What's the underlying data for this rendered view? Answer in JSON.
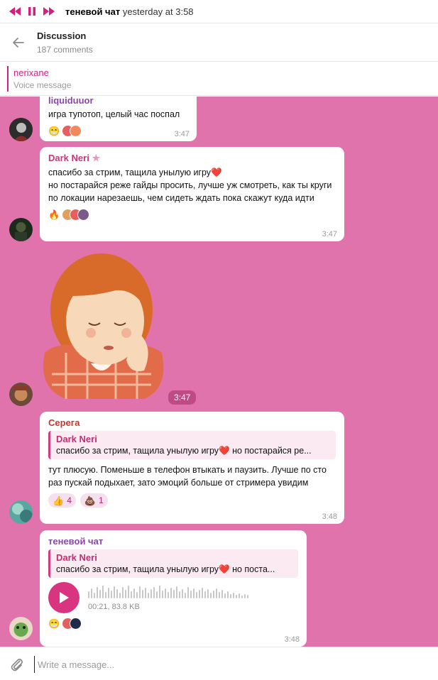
{
  "player": {
    "title": "теневой чат",
    "subtitle": "yesterday at 3:58"
  },
  "header": {
    "title": "Discussion",
    "subtitle": "187 comments"
  },
  "pinned": {
    "name": "nerixane",
    "text": "Voice message"
  },
  "messages": [
    {
      "sender": "liquiduuor",
      "text": "игра тупотоп, целый час поспал",
      "time": "3:47",
      "reactions": [
        "😁"
      ]
    },
    {
      "sender": "Dark Neri",
      "text_line1": "спасибо за стрим, тащила унылую игру❤️",
      "text_rest": "но постарайся реже гайды просить, лучше уж смотреть, как ты круги по локации нарезаешь, чем сидеть ждать пока скажут куда идти",
      "time": "3:47",
      "reactions": [
        "🔥"
      ]
    },
    {
      "type": "sticker",
      "time": "3:47"
    },
    {
      "sender": "Серега",
      "quote_name": "Dark Neri",
      "quote_text": "спасибо за стрим, тащила унылую игру❤️ но постарайся ре...",
      "text": "тут плюсую. Поменьше в телефон втыкать и паузить. Лучше по сто раз пускай подыхает, зато эмоций больше от стримера увидим",
      "time": "3:48",
      "reactions": [
        {
          "emoji": "👍",
          "count": "4"
        },
        {
          "emoji": "💩",
          "count": "1"
        }
      ]
    },
    {
      "sender": "теневой чат",
      "quote_name": "Dark Neri",
      "quote_text": "спасибо за стрим, тащила унылую игру❤️ но поста...",
      "voice_meta": "00:21, 83.8 KB",
      "time": "3:48",
      "reactions": [
        "😁"
      ]
    }
  ],
  "input": {
    "placeholder": "Write a message..."
  },
  "colors": {
    "chat_bg": "#e073ab",
    "accent": "#d8347f",
    "player_accent": "#d21f84"
  }
}
